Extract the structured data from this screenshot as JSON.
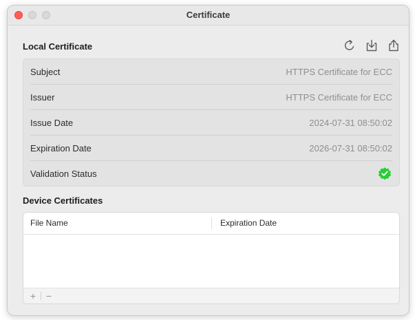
{
  "window": {
    "title": "Certificate"
  },
  "local_certificate": {
    "title": "Local Certificate",
    "toolbar": {
      "refresh_icon": "refresh-icon",
      "import_icon": "download-icon",
      "export_icon": "share-icon"
    },
    "rows": [
      {
        "label": "Subject",
        "value": "HTTPS Certificate for ECC"
      },
      {
        "label": "Issuer",
        "value": "HTTPS Certificate for ECC"
      },
      {
        "label": "Issue Date",
        "value": "2024-07-31 08:50:02"
      },
      {
        "label": "Expiration Date",
        "value": "2026-07-31 08:50:02"
      },
      {
        "label": "Validation Status",
        "value": ""
      }
    ],
    "validation_color": "#25d034"
  },
  "device_certificates": {
    "title": "Device Certificates",
    "columns": [
      "File Name",
      "Expiration Date"
    ],
    "rows": [],
    "add_label": "+",
    "remove_label": "−"
  }
}
